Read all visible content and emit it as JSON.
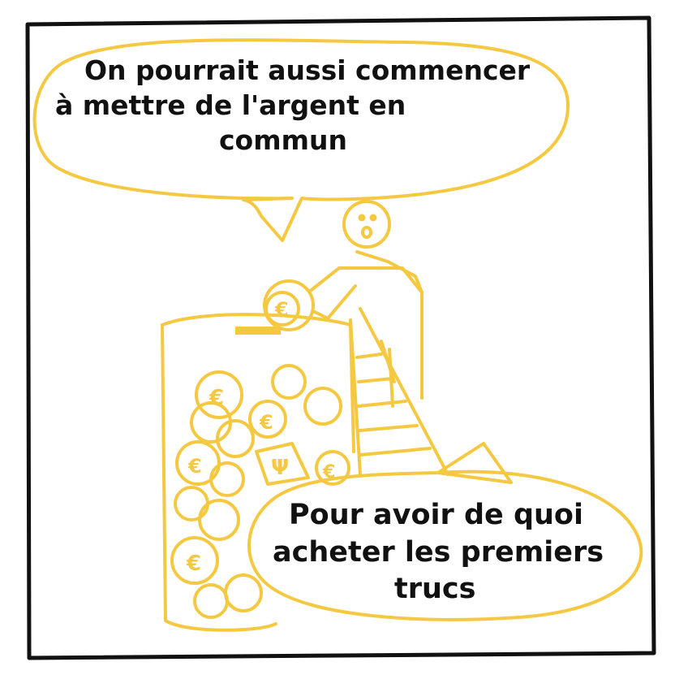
{
  "colors": {
    "frame": "#111111",
    "ink_yellow": "#F5C842",
    "text": "#111111",
    "background": "#ffffff"
  },
  "bubble_top": {
    "lines": [
      "On pourrait aussi commencer",
      "à mettre de l'argent en",
      "commun"
    ]
  },
  "bubble_bottom": {
    "lines": [
      "Pour avoir de quoi",
      "acheter les premiers",
      "trucs"
    ]
  },
  "coins": {
    "euro_symbol": "€",
    "jar_label": "Ψ"
  }
}
